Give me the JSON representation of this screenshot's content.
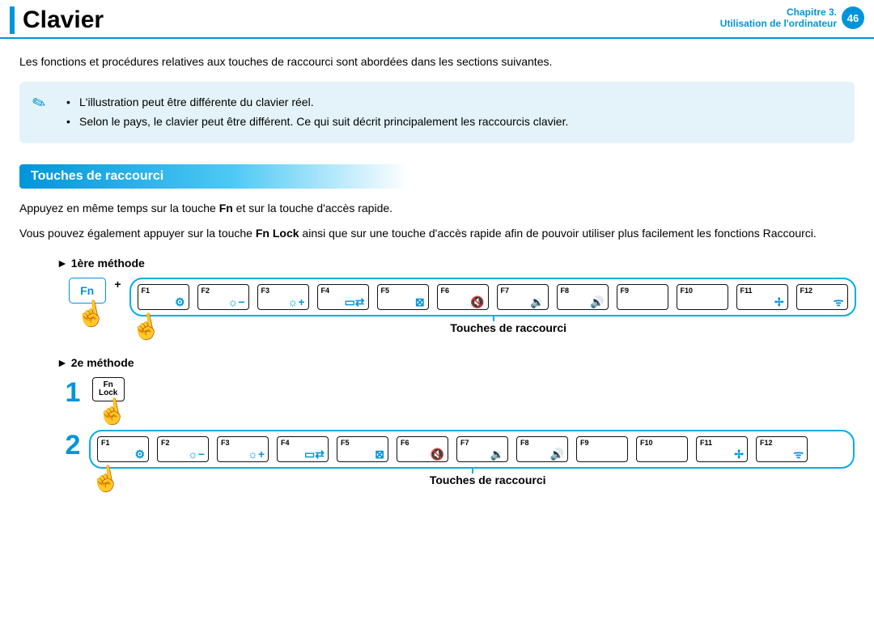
{
  "header": {
    "title": "Clavier",
    "chapter": "Chapitre 3.",
    "subtitle": "Utilisation de l'ordinateur",
    "page": "46"
  },
  "intro": "Les fonctions et procédures relatives aux touches de raccourci sont abordées dans les sections suivantes.",
  "notes": [
    "L'illustration peut être différente du clavier réel.",
    "Selon le pays, le clavier peut être différent. Ce qui suit décrit principalement les raccourcis clavier."
  ],
  "section_heading": "Touches de raccourci",
  "paragraphs": {
    "p1_a": "Appuyez en même temps sur la touche ",
    "p1_b": "Fn",
    "p1_c": " et sur la touche d'accès rapide.",
    "p2_a": "Vous pouvez également appuyer sur la touche ",
    "p2_b": "Fn Lock",
    "p2_c": " ainsi que sur une touche d'accès rapide afin de pouvoir utiliser plus facilement les fonctions Raccourci."
  },
  "method1_label": "► 1ère méthode",
  "method2_label": "► 2e méthode",
  "fn_label": "Fn",
  "plus_label": "+",
  "fn_lock_label_top": "Fn",
  "fn_lock_label_bottom": "Lock",
  "fkeys": [
    {
      "label": "F1",
      "icon": "⚙"
    },
    {
      "label": "F2",
      "icon": "☼−"
    },
    {
      "label": "F3",
      "icon": "☼+"
    },
    {
      "label": "F4",
      "icon": "▭⇄"
    },
    {
      "label": "F5",
      "icon": "⊠"
    },
    {
      "label": "F6",
      "icon": "🔇"
    },
    {
      "label": "F7",
      "icon": "🔉"
    },
    {
      "label": "F8",
      "icon": "🔊"
    },
    {
      "label": "F9",
      "icon": ""
    },
    {
      "label": "F10",
      "icon": ""
    },
    {
      "label": "F11",
      "icon": "✢"
    },
    {
      "label": "F12",
      "icon": "ᯤ"
    }
  ],
  "caption": "Touches de raccourci",
  "steps": {
    "s1": "1",
    "s2": "2"
  }
}
